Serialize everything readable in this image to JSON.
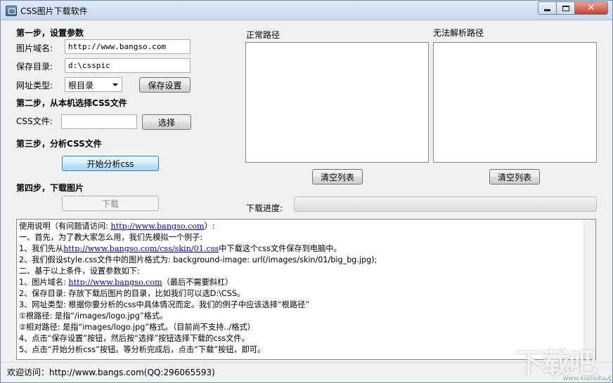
{
  "window": {
    "title": "CSS图片下载软件",
    "close_label": "✕"
  },
  "step1": {
    "heading": "第一步，设置参数",
    "domain_label": "图片域名:",
    "domain_value": "http://www.bangso.com",
    "savedir_label": "保存目录:",
    "savedir_value": "d:\\csspic",
    "urltype_label": "网址类型:",
    "urltype_value": "根目录",
    "save_button": "保存设置"
  },
  "step2": {
    "heading": "第二步，从本机选择CSS文件",
    "cssfile_label": "CSS文件:",
    "cssfile_value": "",
    "choose_button": "选择"
  },
  "step3": {
    "heading": "第三步，分析CSS文件",
    "analyze_button": "开始分析css"
  },
  "step4": {
    "heading": "第四步，下载图片",
    "download_button": "下载",
    "progress_label": "下载进度:",
    "progress_value": 0
  },
  "lists": {
    "normal_label": "正常路径",
    "invalid_label": "无法解析路径",
    "clear_normal": "清空列表",
    "clear_invalid": "清空列表"
  },
  "instructions": {
    "lines": [
      {
        "pre": "使用说明（有问题请访问: ",
        "link": "http://www.bangso.com",
        "post": "）:"
      },
      {
        "pre": "一、首先，为了教大家怎么用，我们先模拟一个例子:",
        "link": "",
        "post": ""
      },
      {
        "pre": "1、我们先从",
        "link": "http://www.bangso.com/css/skin/01.css",
        "post": "中下载这个css文件保存到电脑中。"
      },
      {
        "pre": "2、我们假设style.css文件中的图片格式为: background-image: url(/images/skin/01/big_bg.jpg);",
        "link": "",
        "post": ""
      },
      {
        "pre": "二、基于以上条件，设置参数如下:",
        "link": "",
        "post": ""
      },
      {
        "pre": "1、图片域名: ",
        "link": "http://www.bangso.com",
        "post": "（最后不需要斜杠）"
      },
      {
        "pre": "2、保存目录: 存放下载后图片的目录，比如我们可以选D:\\CSS。",
        "link": "",
        "post": ""
      },
      {
        "pre": "3、网址类型: 根据你要分析的css中具体情况而定。我们的例子中应该选择“根路径”",
        "link": "",
        "post": ""
      },
      {
        "pre": "①根路径: 是指“/images/logo.jpg”格式。",
        "link": "",
        "post": ""
      },
      {
        "pre": "②相对路径: 是指“images/logo.jpg”格式。（目前尚不支持../格式）",
        "link": "",
        "post": ""
      },
      {
        "pre": "4、点击“保存设置”按钮，然后按“选择”按钮选择下载的css文件。",
        "link": "",
        "post": ""
      },
      {
        "pre": "5、点击“开始分析css”按钮。等分析完成后，点击“下载”按钮，即可。",
        "link": "",
        "post": ""
      }
    ]
  },
  "status": {
    "text": "欢迎访问：http://www.bangs.com(QQ:296065593)"
  },
  "watermark": {
    "text": "下载吧",
    "sub": "www.xiazaiba.com"
  }
}
